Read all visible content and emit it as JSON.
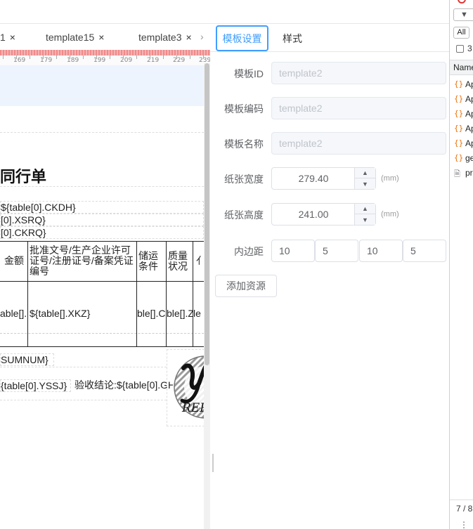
{
  "designer": {
    "tabs": [
      {
        "label": "1"
      },
      {
        "label": "template15"
      },
      {
        "label": "template3"
      }
    ],
    "close_glyph": "×",
    "scroll_glyph": "›",
    "ruler_labels": [
      "169",
      "179",
      "189",
      "199",
      "209",
      "219",
      "229",
      "239"
    ],
    "title": "同行单",
    "fields": {
      "ckdh": "${table[0].CKDH}",
      "xsrq": "[0].XSRQ}",
      "ckrq": "[0].CKRQ}",
      "sumnum": "SUMNUM}",
      "yssj": "{table[0].YSSJ}",
      "ysjl": "验收结论:${table[0].GH"
    },
    "table": {
      "headers": [
        "金额",
        "批准文号/生产企业许可证号/注册证号/备案凭证编号",
        "储运条件",
        "质量状况",
        "亻"
      ],
      "cells": [
        "able[].",
        "${table[].XKZ}",
        "ble[].C",
        "ble[].Z",
        "le"
      ]
    },
    "logo_text": "REP"
  },
  "settings": {
    "tabs": {
      "template": "模板设置",
      "style": "样式"
    },
    "labels": {
      "id": "模板ID",
      "code": "模板编码",
      "name": "模板名称",
      "width": "纸张宽度",
      "height": "纸张高度",
      "padding": "内边距"
    },
    "values": {
      "id": "template2",
      "code": "template2",
      "name": "template2",
      "width": "279.40",
      "height": "241.00",
      "padding": [
        "10",
        "5",
        "10",
        "5"
      ]
    },
    "unit": "(mm)",
    "add_resource": "添加资源"
  },
  "devtools": {
    "filter": "All",
    "check_label": "3",
    "column_name": "Name",
    "rows": [
      {
        "icon": "{}",
        "name": "Ap"
      },
      {
        "icon": "{}",
        "name": "Ap"
      },
      {
        "icon": "{}",
        "name": "Ap"
      },
      {
        "icon": "{}",
        "name": "Ap"
      },
      {
        "icon": "{}",
        "name": "Ap"
      },
      {
        "icon": "{}",
        "name": "ge"
      },
      {
        "icon": "doc",
        "name": "pr"
      }
    ],
    "footer": "7 / 8"
  },
  "colors": {
    "accent": "#409eff",
    "ruler_red": "#f08a8a",
    "canvas_band": "#eef4fd",
    "devtools_orange": "#e8710a"
  }
}
